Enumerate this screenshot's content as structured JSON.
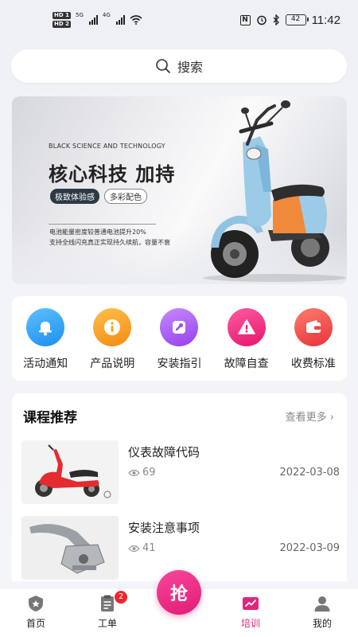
{
  "status_bar": {
    "hd1": "HD 1",
    "hd2": "HD 2",
    "net1": "5G",
    "net2": "4G",
    "battery": "42",
    "time": "11:42"
  },
  "search": {
    "label": "搜索"
  },
  "banner": {
    "en_text": "BLACK SCIENCE AND TECHNOLOGY",
    "title": "核心科技 加持",
    "tag1": "极致体验感",
    "tag2": "多彩配色",
    "line1": "电池能量密度较普通电池提升20%",
    "line2": "支持全线闪充真正实现持久续航，容量不衰"
  },
  "quick_menu": [
    {
      "label": "活动通知",
      "icon": "bell-icon",
      "color": "#2f9ef5"
    },
    {
      "label": "产品说明",
      "icon": "info-icon",
      "color": "#f79c1c"
    },
    {
      "label": "安装指引",
      "icon": "wrench-icon",
      "color": "#a650ef"
    },
    {
      "label": "故障自查",
      "icon": "warning-icon",
      "color": "#ef2a78"
    },
    {
      "label": "收费标准",
      "icon": "wallet-icon",
      "color": "#ef4d4a"
    }
  ],
  "course": {
    "title": "课程推荐",
    "more": "查看更多",
    "items": [
      {
        "title": "仪表故障代码",
        "views": "69",
        "date": "2022-03-08"
      },
      {
        "title": "安装注意事项",
        "views": "41",
        "date": "2022-03-09"
      }
    ]
  },
  "tabbar": {
    "items": [
      {
        "label": "首页"
      },
      {
        "label": "工单",
        "badge": "2"
      },
      {
        "label": "培训"
      },
      {
        "label": "我的"
      }
    ],
    "center_label": "抢",
    "active_color": "#e2257c"
  }
}
